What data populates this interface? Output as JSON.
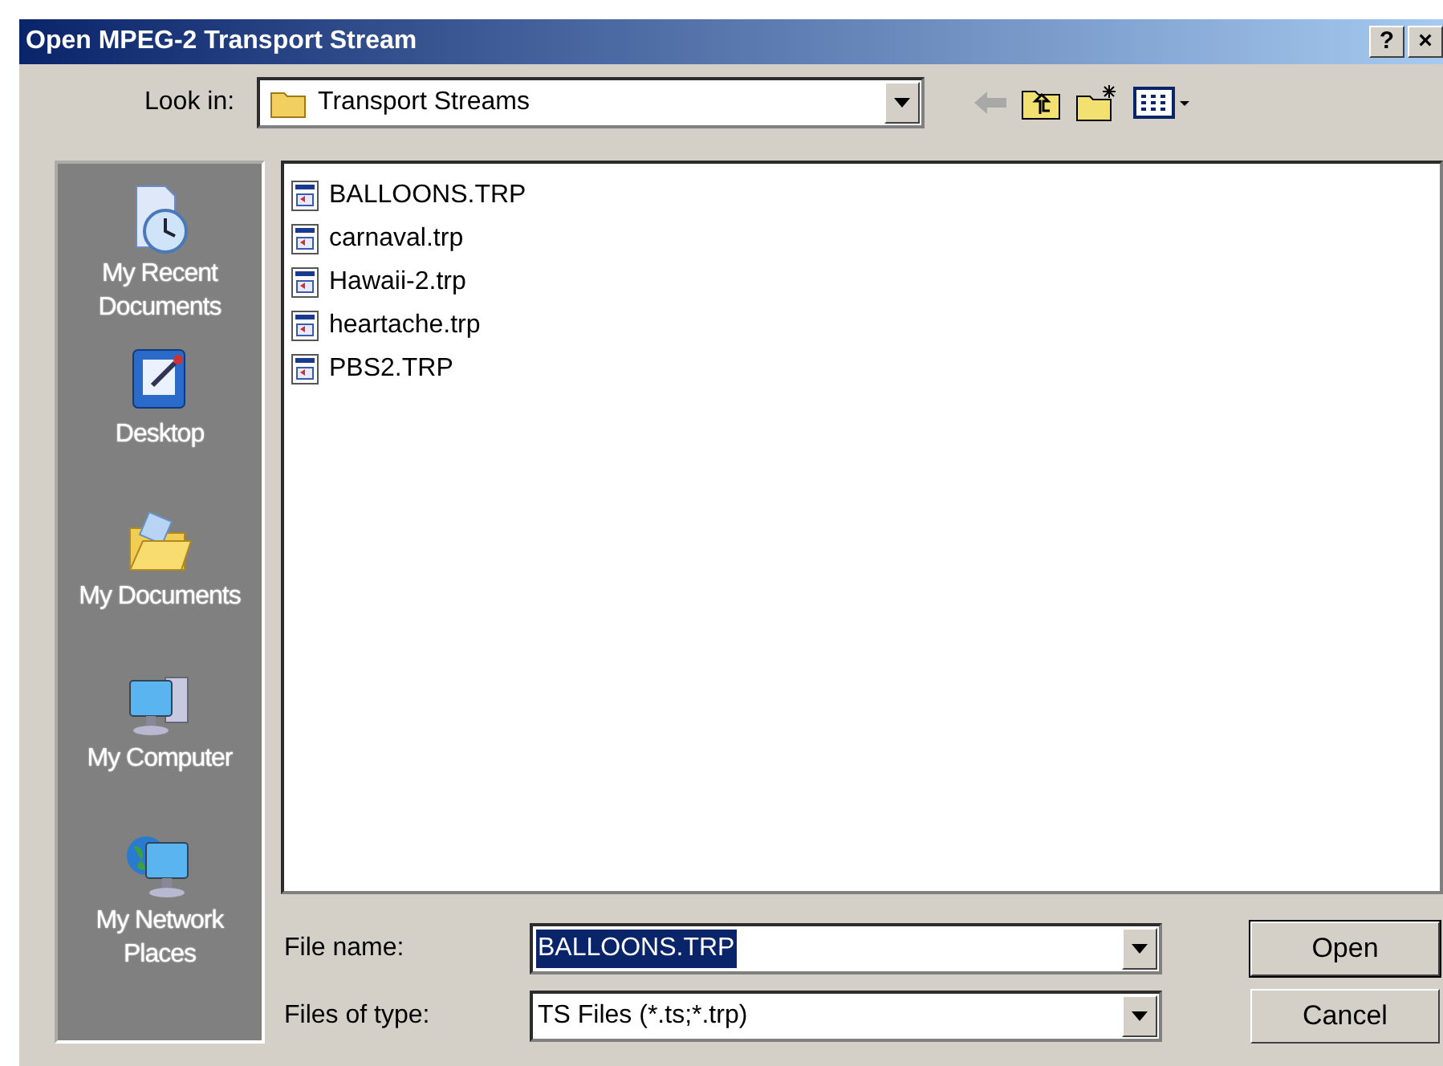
{
  "window": {
    "title": "Open MPEG-2 Transport Stream",
    "title_buttons": [
      "?",
      "×"
    ]
  },
  "look_in": {
    "label": "Look in:",
    "value": "Transport Streams"
  },
  "places": [
    {
      "kind": "recent",
      "label": "My Recent Documents"
    },
    {
      "kind": "desktop",
      "label": "Desktop"
    },
    {
      "kind": "documents",
      "label": "My Documents"
    },
    {
      "kind": "computer",
      "label": "My Computer"
    },
    {
      "kind": "network",
      "label": "My Network Places"
    }
  ],
  "files": [
    "BALLOONS.TRP",
    "carnaval.trp",
    "Hawaii-2.trp",
    "heartache.trp",
    "PBS2.TRP"
  ],
  "file_name": {
    "label": "File name:",
    "value": "BALLOONS.TRP",
    "text_selected": true
  },
  "file_type": {
    "label": "Files of type:",
    "value": "TS Files (*.ts;*.trp)"
  },
  "buttons": [
    {
      "label": "Open",
      "default": true
    },
    {
      "label": "Cancel",
      "default": false
    }
  ]
}
